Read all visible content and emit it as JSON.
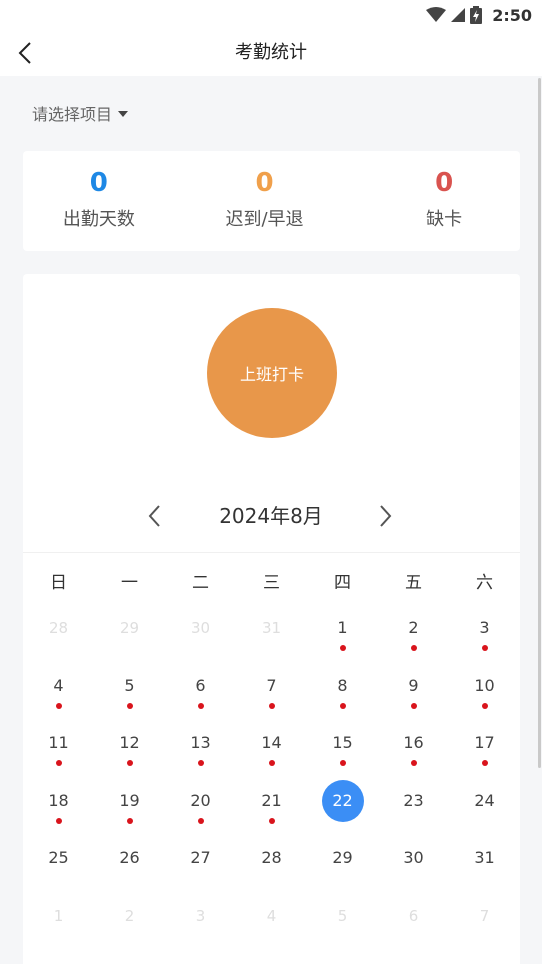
{
  "status_bar": {
    "time": "2:50"
  },
  "header": {
    "title": "考勤统计"
  },
  "selector": {
    "label": "请选择项目"
  },
  "stats": [
    {
      "value": "0",
      "label": "出勤天数",
      "color": "#1e88e5"
    },
    {
      "value": "0",
      "label": "迟到/早退",
      "color": "#f0a04b"
    },
    {
      "value": "0",
      "label": "缺卡",
      "color": "#d9534f"
    }
  ],
  "clock_button": {
    "label": "上班打卡",
    "color": "#e8974a"
  },
  "calendar": {
    "month_label": "2024年8月",
    "weekdays": [
      "日",
      "一",
      "二",
      "三",
      "四",
      "五",
      "六"
    ],
    "accent_color": "#3b8ef5",
    "dot_color": "#d9141c",
    "days": [
      {
        "n": "28",
        "muted": true
      },
      {
        "n": "29",
        "muted": true
      },
      {
        "n": "30",
        "muted": true
      },
      {
        "n": "31",
        "muted": true
      },
      {
        "n": "1",
        "dot": true
      },
      {
        "n": "2",
        "dot": true
      },
      {
        "n": "3",
        "dot": true
      },
      {
        "n": "4",
        "dot": true
      },
      {
        "n": "5",
        "dot": true
      },
      {
        "n": "6",
        "dot": true
      },
      {
        "n": "7",
        "dot": true
      },
      {
        "n": "8",
        "dot": true
      },
      {
        "n": "9",
        "dot": true
      },
      {
        "n": "10",
        "dot": true
      },
      {
        "n": "11",
        "dot": true
      },
      {
        "n": "12",
        "dot": true
      },
      {
        "n": "13",
        "dot": true
      },
      {
        "n": "14",
        "dot": true
      },
      {
        "n": "15",
        "dot": true
      },
      {
        "n": "16",
        "dot": true
      },
      {
        "n": "17",
        "dot": true
      },
      {
        "n": "18",
        "dot": true
      },
      {
        "n": "19",
        "dot": true
      },
      {
        "n": "20",
        "dot": true
      },
      {
        "n": "21",
        "dot": true
      },
      {
        "n": "22",
        "selected": true
      },
      {
        "n": "23"
      },
      {
        "n": "24"
      },
      {
        "n": "25"
      },
      {
        "n": "26"
      },
      {
        "n": "27"
      },
      {
        "n": "28"
      },
      {
        "n": "29"
      },
      {
        "n": "30"
      },
      {
        "n": "31"
      },
      {
        "n": "1",
        "muted": true
      },
      {
        "n": "2",
        "muted": true
      },
      {
        "n": "3",
        "muted": true
      },
      {
        "n": "4",
        "muted": true
      },
      {
        "n": "5",
        "muted": true
      },
      {
        "n": "6",
        "muted": true
      },
      {
        "n": "7",
        "muted": true
      }
    ]
  }
}
